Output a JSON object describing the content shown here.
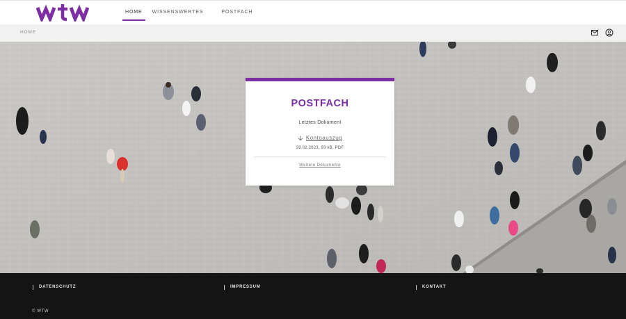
{
  "brand": {
    "logo_text": "wtw",
    "logo_color": "#7b2fa3"
  },
  "nav": {
    "items": [
      {
        "label": "HOME",
        "active": true
      },
      {
        "label": "WISSENSWERTES",
        "active": false
      },
      {
        "label": "POSTFACH",
        "active": false
      }
    ]
  },
  "breadcrumb": {
    "current": "HOME"
  },
  "header_icons": {
    "mail": "mail-icon",
    "user": "user-icon"
  },
  "card": {
    "title": "POSTFACH",
    "subtitle": "Letztes Dokument",
    "document_label": "Kontoauszug",
    "document_meta": "28.02.2023, 93 kB, PDF",
    "more_label": "Weitere Dokumente",
    "accent_color": "#7b2fa3"
  },
  "footer": {
    "links": [
      "DATENSCHUTZ",
      "IMPRESSUM",
      "KONTAKT"
    ],
    "copyright": "© WTW"
  }
}
